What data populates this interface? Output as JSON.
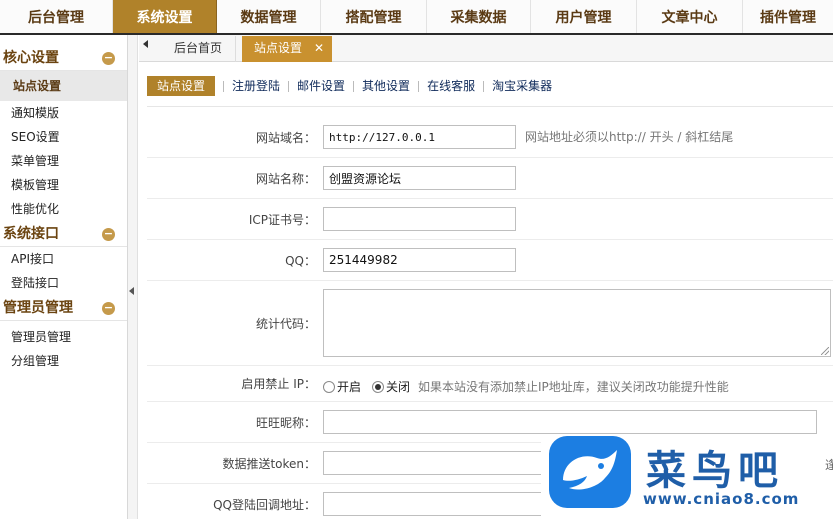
{
  "topnav": [
    "后台管理",
    "系统设置",
    "数据管理",
    "搭配管理",
    "采集数据",
    "用户管理",
    "文章中心",
    "插件管理"
  ],
  "topnav_active": 1,
  "sidebar": {
    "core_title": "核心设置",
    "core_items": [
      "站点设置",
      "通知模版",
      "SEO设置",
      "菜单管理",
      "模板管理",
      "性能优化"
    ],
    "api_title": "系统接口",
    "api_items": [
      "API接口",
      "登陆接口"
    ],
    "admin_title": "管理员管理",
    "admin_items": [
      "管理员管理",
      "分组管理"
    ],
    "collapse_symbol": "−"
  },
  "tabs": {
    "home": "后台首页",
    "current": "站点设置",
    "close_symbol": "✕"
  },
  "subnav": [
    "站点设置",
    "注册登陆",
    "邮件设置",
    "其他设置",
    "在线客服",
    "淘宝采集器"
  ],
  "form": {
    "domain": {
      "label": "网站域名：",
      "value": "http://127.0.0.1",
      "hint": "网站地址必须以http:// 开头 / 斜杠结尾"
    },
    "sitename": {
      "label": "网站名称：",
      "value": "创盟资源论坛"
    },
    "icp": {
      "label": "ICP证书号：",
      "value": ""
    },
    "qq": {
      "label": "QQ：",
      "value": "251449982"
    },
    "stats": {
      "label": "统计代码：",
      "value": ""
    },
    "ipban": {
      "label": "启用禁止 IP：",
      "option_on": "开启",
      "option_off": "关闭",
      "selected": "关闭",
      "hint": "如果本站没有添加禁止IP地址库，建议关闭改功能提升性能"
    },
    "wangwang": {
      "label": "旺旺昵称：",
      "value": ""
    },
    "token": {
      "label": "数据推送token：",
      "value": ""
    },
    "qqcallback": {
      "label": "QQ登陆回调地址：",
      "value": ""
    }
  },
  "watermark": {
    "name": "菜鸟吧",
    "url": "www.cniao8.com",
    "edge_char": "逢"
  },
  "colors": {
    "accent": "#b0822a",
    "tab_active": "#c9912f",
    "group_title": "#6b4411",
    "watermark_blue": "#1c7ee2"
  }
}
